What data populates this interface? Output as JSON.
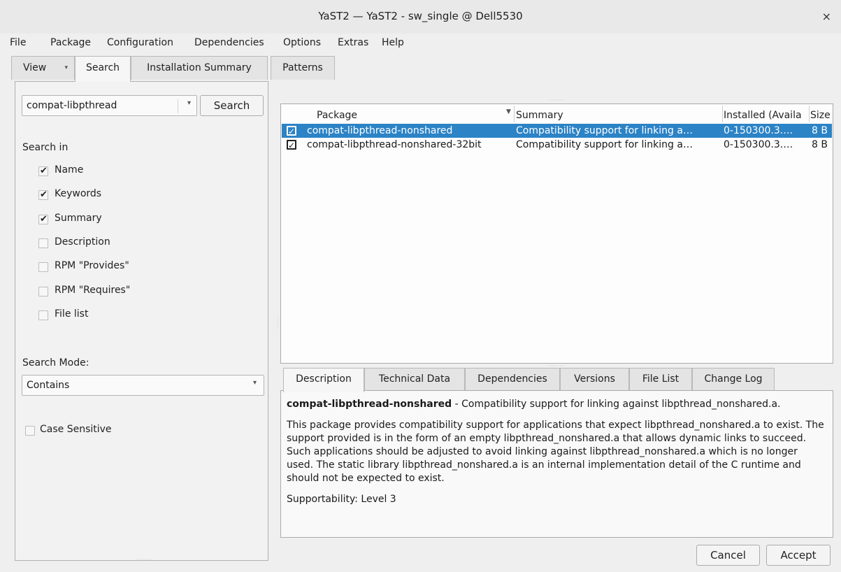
{
  "window": {
    "title": "YaST2 — YaST2 - sw_single @ Dell5530",
    "close_glyph": "×"
  },
  "menu": [
    "File",
    "Package",
    "Configuration",
    "Dependencies",
    "Options",
    "Extras",
    "Help"
  ],
  "top_tabs": {
    "view": "View",
    "search": "Search",
    "installation_summary": "Installation Summary",
    "patterns": "Patterns"
  },
  "search": {
    "query": "compat-libpthread",
    "button": "Search",
    "search_in_label": "Search in",
    "options": [
      {
        "label": "Name",
        "checked": true
      },
      {
        "label": "Keywords",
        "checked": true
      },
      {
        "label": "Summary",
        "checked": true
      },
      {
        "label": "Description",
        "checked": false
      },
      {
        "label": "RPM \"Provides\"",
        "checked": false
      },
      {
        "label": "RPM \"Requires\"",
        "checked": false
      },
      {
        "label": "File list",
        "checked": false
      }
    ],
    "mode_label": "Search Mode:",
    "mode_value": "Contains",
    "case_sensitive_label": "Case Sensitive",
    "case_sensitive_checked": false
  },
  "packages": {
    "columns": {
      "package": "Package",
      "summary": "Summary",
      "installed": "Installed (Availa",
      "size": "Size"
    },
    "rows": [
      {
        "name": "compat-libpthread-nonshared",
        "summary": "Compatibility support for linking a…",
        "installed": "0-150300.3.…",
        "size": "8 B",
        "checked": true,
        "selected": true
      },
      {
        "name": "compat-libpthread-nonshared-32bit",
        "summary": "Compatibility support for linking a…",
        "installed": "0-150300.3.…",
        "size": "8 B",
        "checked": true,
        "selected": false
      }
    ]
  },
  "detail_tabs": [
    "Description",
    "Technical Data",
    "Dependencies",
    "Versions",
    "File List",
    "Change Log"
  ],
  "description": {
    "pkg_name": "compat-libpthread-nonshared",
    "pkg_summary": " - Compatibility support for linking against libpthread_nonshared.a.",
    "body": "This package provides compatibility support for applications that expect libpthread_nonshared.a to exist. The support provided is in the form of an empty libpthread_nonshared.a that allows dynamic links to succeed. Such applications should be adjusted to avoid linking against libpthread_nonshared.a which is no longer used. The static library libpthread_nonshared.a is an internal implementation detail of the C runtime and should not be expected to exist.",
    "supportability": "Supportability: Level 3"
  },
  "buttons": {
    "cancel": "Cancel",
    "accept": "Accept"
  },
  "colors": {
    "selection": "#2c83c6"
  }
}
